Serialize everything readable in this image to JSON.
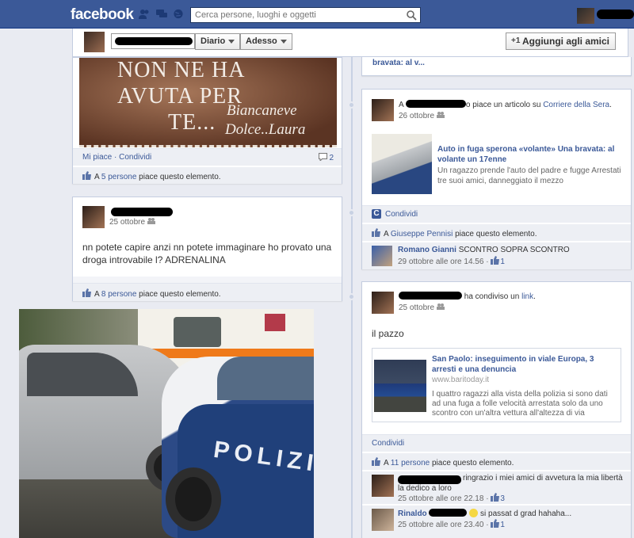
{
  "topbar": {
    "logo": "facebook",
    "search_placeholder": "Cerca persone, luoghi e oggetti",
    "colors": {
      "brand": "#3b5998"
    }
  },
  "timeline_bar": {
    "diario_label": "Diario",
    "adesso_label": "Adesso",
    "add_friend_label": "Aggiungi agli amici"
  },
  "left_col": {
    "image_post": {
      "image_text_line1": "NON NE HA",
      "image_text_line2": "AVUTA PER",
      "image_text_line3": "TE...",
      "image_sig1": "Biancaneve",
      "image_sig2": "Dolce..Laura",
      "actions": "Mi piace · Condividi",
      "comment_count": "2",
      "likes_prefix": "A ",
      "likes_link": "5 persone",
      "likes_suffix": " piace questo elemento."
    },
    "status_post": {
      "date": "25 ottobre",
      "text": "nn potete capire anzi nn potete immaginare ho provato una droga introvabile l? ADRENALINA",
      "likes_prefix": "A ",
      "likes_link": "8 persone",
      "likes_suffix": " piace questo elemento."
    },
    "photo": {
      "police_text": "POLIZI"
    }
  },
  "right_col": {
    "top_card": {
      "text": "bravata: al v..."
    },
    "article_post": {
      "prefix": "A ",
      "action": "o piace un articolo su ",
      "source": "Corriere della Sera",
      "date": "26 ottobre",
      "article_title": "Auto in fuga sperona «volante» Una bravata: al volante un 17enne",
      "article_desc": "Un ragazzo prende l'auto del padre e fugge Arrestati tre suoi amici, danneggiato il mezzo",
      "share_label": "Condividi",
      "likes_prefix": "A ",
      "likes_link": "Giuseppe Pennisi",
      "likes_suffix": " piace questo elemento.",
      "comment_author": "Romano Gianni",
      "comment_text": "SCONTRO SOPRA SCONTRO",
      "comment_date": "29 ottobre alle ore 14.56",
      "comment_likes": "1"
    },
    "link_post": {
      "action": "ha condiviso un ",
      "action_link": "link",
      "date": "25 ottobre",
      "text": "il pazzo",
      "link_title": "San Paolo: inseguimento in viale Europa, 3 arresti e una denuncia",
      "link_domain": "www.baritoday.it",
      "link_desc": "I quattro ragazzi alla vista della polizia si sono dati ad una fuga a folle velocità arrestata solo da uno scontro con un'altra vettura all'altezza di via",
      "share_label": "Condividi",
      "likes_prefix": "A ",
      "likes_link": "11 persone",
      "likes_suffix": " piace questo elemento.",
      "comment1_text": "ringrazio i miei amici di avvetura la mia libertà la dedico a loro",
      "comment1_date": "25 ottobre alle ore 22.18",
      "comment1_likes": "3",
      "comment2_author": "Rinaldo",
      "comment2_text": "si passat d grad hahaha...",
      "comment2_date": "25 ottobre alle ore 23.40",
      "comment2_likes": "1"
    }
  }
}
